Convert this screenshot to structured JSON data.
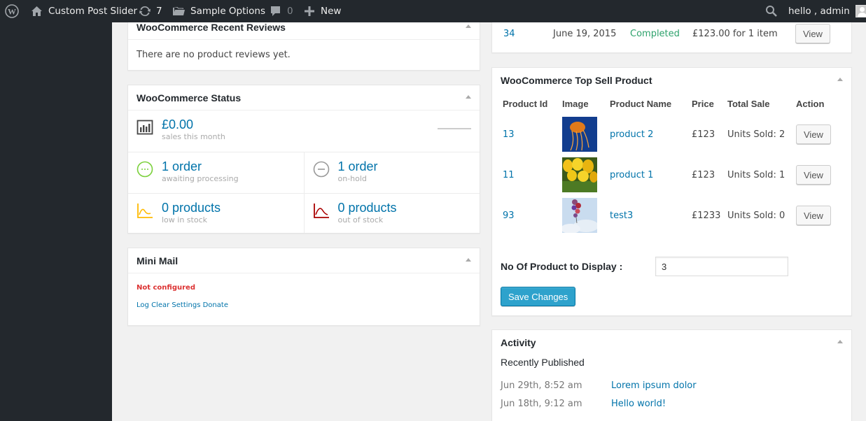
{
  "adminbar": {
    "site_name": "Custom Post Slider",
    "updates_count": "7",
    "sample_options": "Sample Options",
    "comments_count": "0",
    "new_label": "New",
    "greeting": "hello , admin"
  },
  "recent_reviews": {
    "title": "WooCommerce Recent Reviews",
    "empty_text": "There are no product reviews yet."
  },
  "status": {
    "title": "WooCommerce Status",
    "sales_amount": "£0.00",
    "sales_label": "sales this month",
    "processing_count": "1 order",
    "processing_label": "awaiting processing",
    "onhold_count": "1 order",
    "onhold_label": "on-hold",
    "lowstock_count": "0 products",
    "lowstock_label": "low in stock",
    "outstock_count": "0 products",
    "outstock_label": "out of stock"
  },
  "mini_mail": {
    "title": "Mini Mail",
    "status": "Not configured",
    "links": [
      "Log",
      "Clear",
      "Settings",
      "Donate"
    ]
  },
  "recent_orders": {
    "row": {
      "id": "34",
      "date": "June 19, 2015",
      "status": "Completed",
      "total": "£123.00 for 1 item",
      "action": "View"
    }
  },
  "top_sell": {
    "title": "WooCommerce Top Sell Product",
    "headers": [
      "Product Id",
      "Image",
      "Product Name",
      "Price",
      "Total Sale",
      "Action"
    ],
    "rows": [
      {
        "id": "13",
        "name": "product 2",
        "price": "£123",
        "sale": "Units Sold: 2",
        "action": "View",
        "image": "jellyfish"
      },
      {
        "id": "11",
        "name": "product 1",
        "price": "£123",
        "sale": "Units Sold: 1",
        "action": "View",
        "image": "tulips"
      },
      {
        "id": "93",
        "name": "test3",
        "price": "£1233",
        "sale": "Units Sold: 0",
        "action": "View",
        "image": "balloons"
      }
    ],
    "display_label": "No Of Product to Display :",
    "display_value": "3",
    "save_label": "Save Changes"
  },
  "activity": {
    "title": "Activity",
    "section": "Recently Published",
    "items": [
      {
        "date": "Jun 29th, 8:52 am",
        "title": "Lorem ipsum dolor"
      },
      {
        "date": "Jun 18th, 9:12 am",
        "title": "Hello world!"
      }
    ]
  },
  "colors": {
    "adminbar": "#23282d",
    "link": "#0073aa",
    "completed": "#2ea26c",
    "error": "#dc3232",
    "primary_button": "#2ea2cc"
  }
}
